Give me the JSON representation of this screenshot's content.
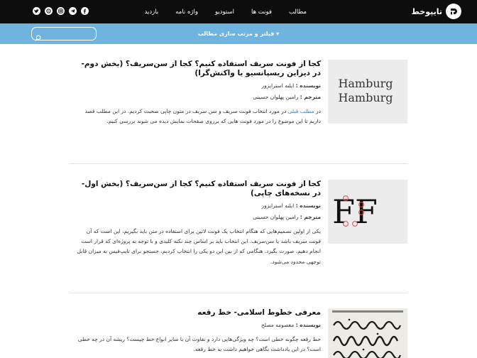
{
  "brand": {
    "name": "تایپوخط"
  },
  "nav": [
    "مطالب",
    "فونت ها",
    "استودیو",
    "واژه نامه",
    "بازدید"
  ],
  "social_icons": [
    "facebook-icon",
    "telegram-icon",
    "instagram-icon",
    "aparat-icon",
    "twitter-icon"
  ],
  "filter": {
    "label": "▾ فیلتر و مرتب سازی مطالب"
  },
  "search": {
    "placeholder": ""
  },
  "labels": {
    "author": "نویسنده :",
    "translator": "مترجم :"
  },
  "articles": [
    {
      "title": "کجا از فونت سریف استفاده کنیم؟ کجا از سن‌سریف؟ (بخش دوم- در دیزاین ریسپانسیو یا واکنش‌گرا)",
      "author": "ایلنه استرایزور",
      "translator": "رامین پهلوان حسینی",
      "excerpt_prefix": "در ",
      "excerpt_link": "مطلب قبلی",
      "excerpt": " در مورد انتخاب فونت سریف و سن سریف در متون چاپی صحبت کردیم. در این مطلب قصد داریم تا این موضوع را در مورد فونت هایی که برروی صفحات نمایش دیده می شوند بررسی کنیم.",
      "thumb": {
        "line1": "Hamburg",
        "line2": "Hamburg"
      }
    },
    {
      "title": "کجا از فونت سریف استفاده کنیم؟ کجا از سن‌سریف؟ (بخش اول- در نسخه‌های چاپی)",
      "author": "ایلنه استرایزور",
      "translator": "رامین پهلوان حسینی",
      "excerpt": "یکی از اولین تصمیم‌هایی که هنگام انتخاب یک فونت لاتین برای استفاده در متن باید بگیریم، این است که آن فونت سریف باشد یا سن‌سریف. این انتخاب باید بر اساس چند نکته کلیدی و با توجه به پروژه‌ای که قرار است انجام دهیم، صورت بگیرد. هنگامی که از بین این دو یکی را انتخاب کردیم، جستجو برای تایپ‌فیس به میزان قابل توجهی محدود می‌شود.",
      "thumb": {
        "letters": "FF"
      }
    },
    {
      "title": "معرفی خطوط اسلامی- خط رقعه",
      "author": "معصومه مصلح",
      "excerpt": "خط رقعه چگونه خطی است؟ چه ویژگی‌هایی دارد و تفاوت آن با سایر انواع خط چیست؟ ریشه آن در چه خطی است؟ در این یادداشت نگاهی خواهیم داشت به خط رقعه."
    }
  ]
}
